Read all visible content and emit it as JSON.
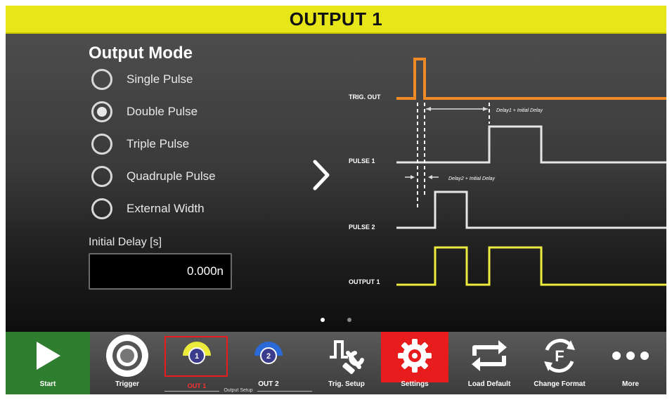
{
  "header": {
    "title": "OUTPUT 1"
  },
  "output_mode": {
    "heading": "Output Mode",
    "options": [
      {
        "label": "Single Pulse",
        "selected": false
      },
      {
        "label": "Double Pulse",
        "selected": true
      },
      {
        "label": "Triple Pulse",
        "selected": false
      },
      {
        "label": "Quadruple Pulse",
        "selected": false
      },
      {
        "label": "External Width",
        "selected": false
      }
    ]
  },
  "initial_delay": {
    "label": "Initial Delay [s]",
    "value": "0.000n"
  },
  "timing_diagram": {
    "signals": [
      "TRIG. OUT",
      "PULSE 1",
      "PULSE 2",
      "OUTPUT 1"
    ],
    "annotations": [
      "Delay1 + Initial Delay",
      "Delay2 + Initial Delay"
    ],
    "colors": {
      "trig": "#f08a24",
      "pulse": "#e6e6e6",
      "output": "#ecec3c",
      "accent": "#e6e619"
    }
  },
  "pager": {
    "count": 2,
    "active": 1
  },
  "toolbar": {
    "items": [
      {
        "id": "start",
        "label": "Start",
        "icon": "play-icon"
      },
      {
        "id": "trigger",
        "label": "Trigger",
        "icon": "trigger-icon"
      },
      {
        "id": "out1",
        "label": "OUT 1",
        "icon": "output-1-icon"
      },
      {
        "id": "out2",
        "label": "OUT 2",
        "icon": "output-2-icon"
      },
      {
        "id": "trig-setup",
        "label": "Trig. Setup",
        "icon": "trig-setup-icon"
      },
      {
        "id": "settings",
        "label": "Settings",
        "icon": "gear-icon"
      },
      {
        "id": "load-default",
        "label": "Load Default",
        "icon": "refresh-icon"
      },
      {
        "id": "change-format",
        "label": "Change Format",
        "icon": "format-icon"
      },
      {
        "id": "more",
        "label": "More",
        "icon": "more-icon"
      }
    ],
    "selected_caption": "OUT 1",
    "group_caption": "Output Setup"
  }
}
